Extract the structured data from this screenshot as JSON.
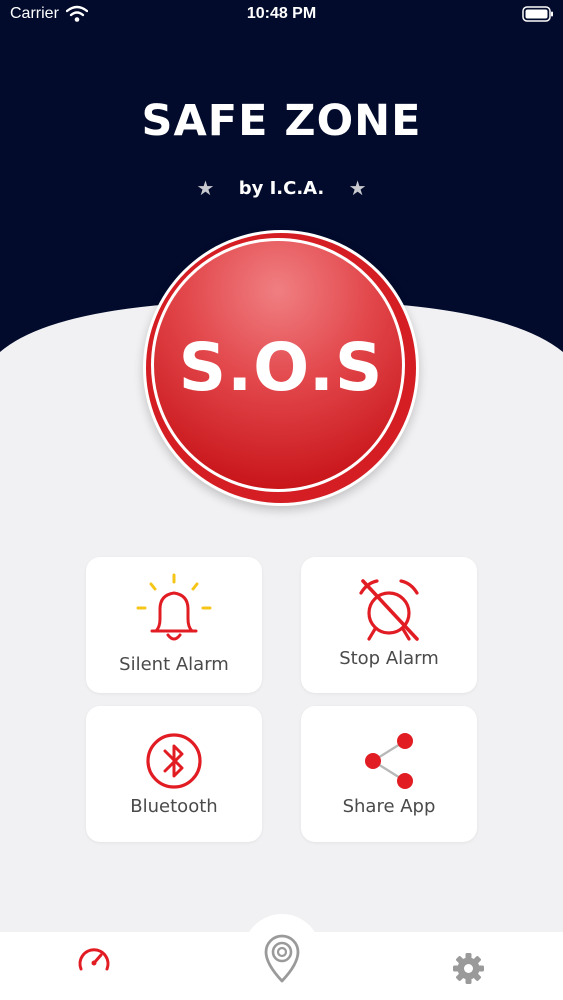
{
  "status_bar": {
    "carrier": "Carrier",
    "time": "10:48 PM"
  },
  "header": {
    "title": "SAFE ZONE",
    "subtitle": "by I.C.A.",
    "star_glyph": "★"
  },
  "sos": {
    "label": "S.O.S"
  },
  "actions": {
    "silent_alarm": "Silent Alarm",
    "stop_alarm": "Stop Alarm",
    "bluetooth": "Bluetooth",
    "share_app": "Share App"
  },
  "bottom_nav": {
    "items": [
      "speedometer-icon",
      "location-pin-icon",
      "settings-gear-icon"
    ],
    "active": "speedometer-icon"
  },
  "colors": {
    "header_bg": "#020b2c",
    "accent_red": "#e21c23",
    "background": "#f1f1f3",
    "card_bg": "#ffffff",
    "label_text": "#4a4a4a",
    "bell_rays": "#f5c518",
    "inactive_icon": "#9a9a9a"
  }
}
